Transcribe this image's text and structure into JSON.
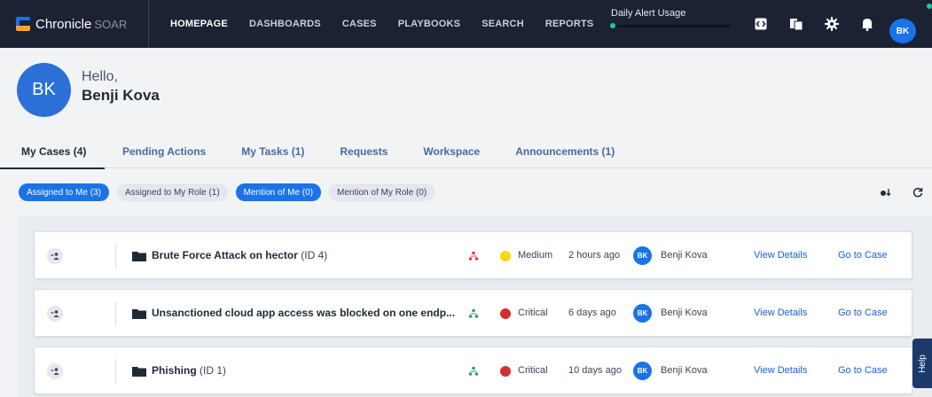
{
  "app": {
    "brand": "Chronicle",
    "brand_suffix": "SOAR",
    "accent": "#1a73e8",
    "nav_bg": "#1b2233"
  },
  "nav": {
    "items": [
      {
        "label": "HOMEPAGE",
        "active": true
      },
      {
        "label": "DASHBOARDS",
        "active": false
      },
      {
        "label": "CASES",
        "active": false
      },
      {
        "label": "PLAYBOOKS",
        "active": false
      },
      {
        "label": "SEARCH",
        "active": false
      },
      {
        "label": "REPORTS",
        "active": false
      }
    ],
    "alert_usage_label": "Daily Alert Usage",
    "icons": [
      "code-icon",
      "notes-icon",
      "settings-gear-icon",
      "notification-bell-icon"
    ],
    "user_initials": "BK"
  },
  "greeting": {
    "initials": "BK",
    "hello": "Hello,",
    "name": "Benji Kova"
  },
  "tabs": [
    {
      "label": "My Cases (4)",
      "active": true
    },
    {
      "label": "Pending Actions",
      "active": false
    },
    {
      "label": "My Tasks (1)",
      "active": false
    },
    {
      "label": "Requests",
      "active": false
    },
    {
      "label": "Workspace",
      "active": false
    },
    {
      "label": "Announcements (1)",
      "active": false
    }
  ],
  "filters": [
    {
      "label": "Assigned to Me (3)",
      "active": true
    },
    {
      "label": "Assigned to My Role (1)",
      "active": false
    },
    {
      "label": "Mention of Me (0)",
      "active": true
    },
    {
      "label": "Mention of My Role (0)",
      "active": false
    }
  ],
  "cases": [
    {
      "title": "Brute Force Attack on hector",
      "id": "(ID 4)",
      "priority": "Medium",
      "priority_color": "#f5d90a",
      "stage_color": "#e53935",
      "time": "2 hours ago",
      "owner_initials": "BK",
      "owner": "Benji Kova",
      "view": "View Details",
      "go": "Go to Case"
    },
    {
      "title": "Unsanctioned cloud app access was blocked on one endp...",
      "id": "",
      "priority": "Critical",
      "priority_color": "#d32f2f",
      "stage_color": "#2e9e5b",
      "time": "6 days ago",
      "owner_initials": "BK",
      "owner": "Benji Kova",
      "view": "View Details",
      "go": "Go to Case"
    },
    {
      "title": "Phishing",
      "id": "(ID 1)",
      "priority": "Critical",
      "priority_color": "#d32f2f",
      "stage_color": "#2e9e5b",
      "time": "10 days ago",
      "owner_initials": "BK",
      "owner": "Benji Kova",
      "view": "View Details",
      "go": "Go to Case"
    }
  ],
  "help_label": "Help"
}
